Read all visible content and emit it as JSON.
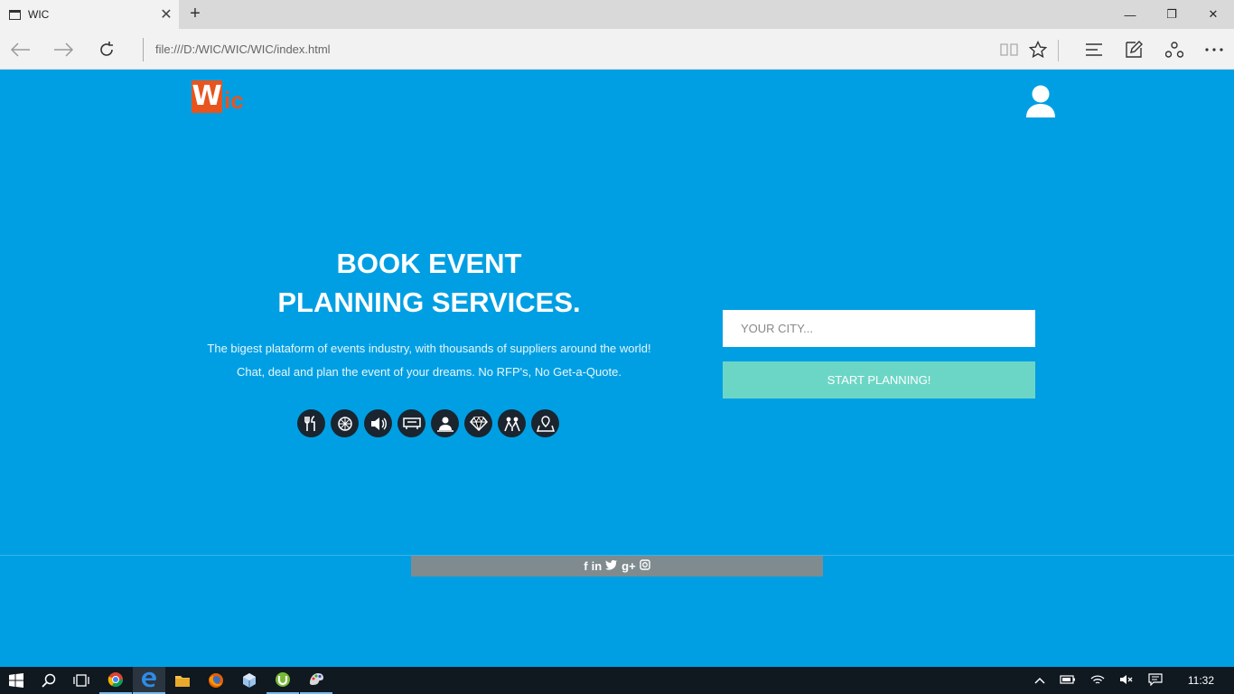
{
  "browser": {
    "tab_title": "WIC",
    "tab_close": "✕",
    "new_tab": "+",
    "url": "file:///D:/WIC/WIC/WIC/index.html",
    "window_controls": {
      "minimize": "—",
      "restore": "❐",
      "close": "✕"
    }
  },
  "page": {
    "logo": {
      "mark": "W",
      "rest": "ic"
    },
    "headline_line1": "BOOK EVENT",
    "headline_line2": "PLANNING SERVICES.",
    "sub_line1": "The bigest plataform of events industry, with thousands of suppliers around the world!",
    "sub_line2": "Chat, deal and plan the event of your dreams. No RFP's, No Get-a-Quote.",
    "services": [
      "catering-icon",
      "decoration-icon",
      "audio-video-icon",
      "venue-icon",
      "entertainment-icon",
      "jewelry-icon",
      "party-icon",
      "location-icon"
    ],
    "city_placeholder": "YOUR CITY...",
    "start_button": "START PLANNING!",
    "social": [
      "f",
      "in",
      "🐦",
      "g+",
      "◙"
    ]
  },
  "taskbar": {
    "time": "11:32"
  },
  "colors": {
    "page_bg": "#009fe3",
    "logo": "#e8541e",
    "start_button": "#6cd6c6",
    "social_bar": "#7f8b8f"
  }
}
